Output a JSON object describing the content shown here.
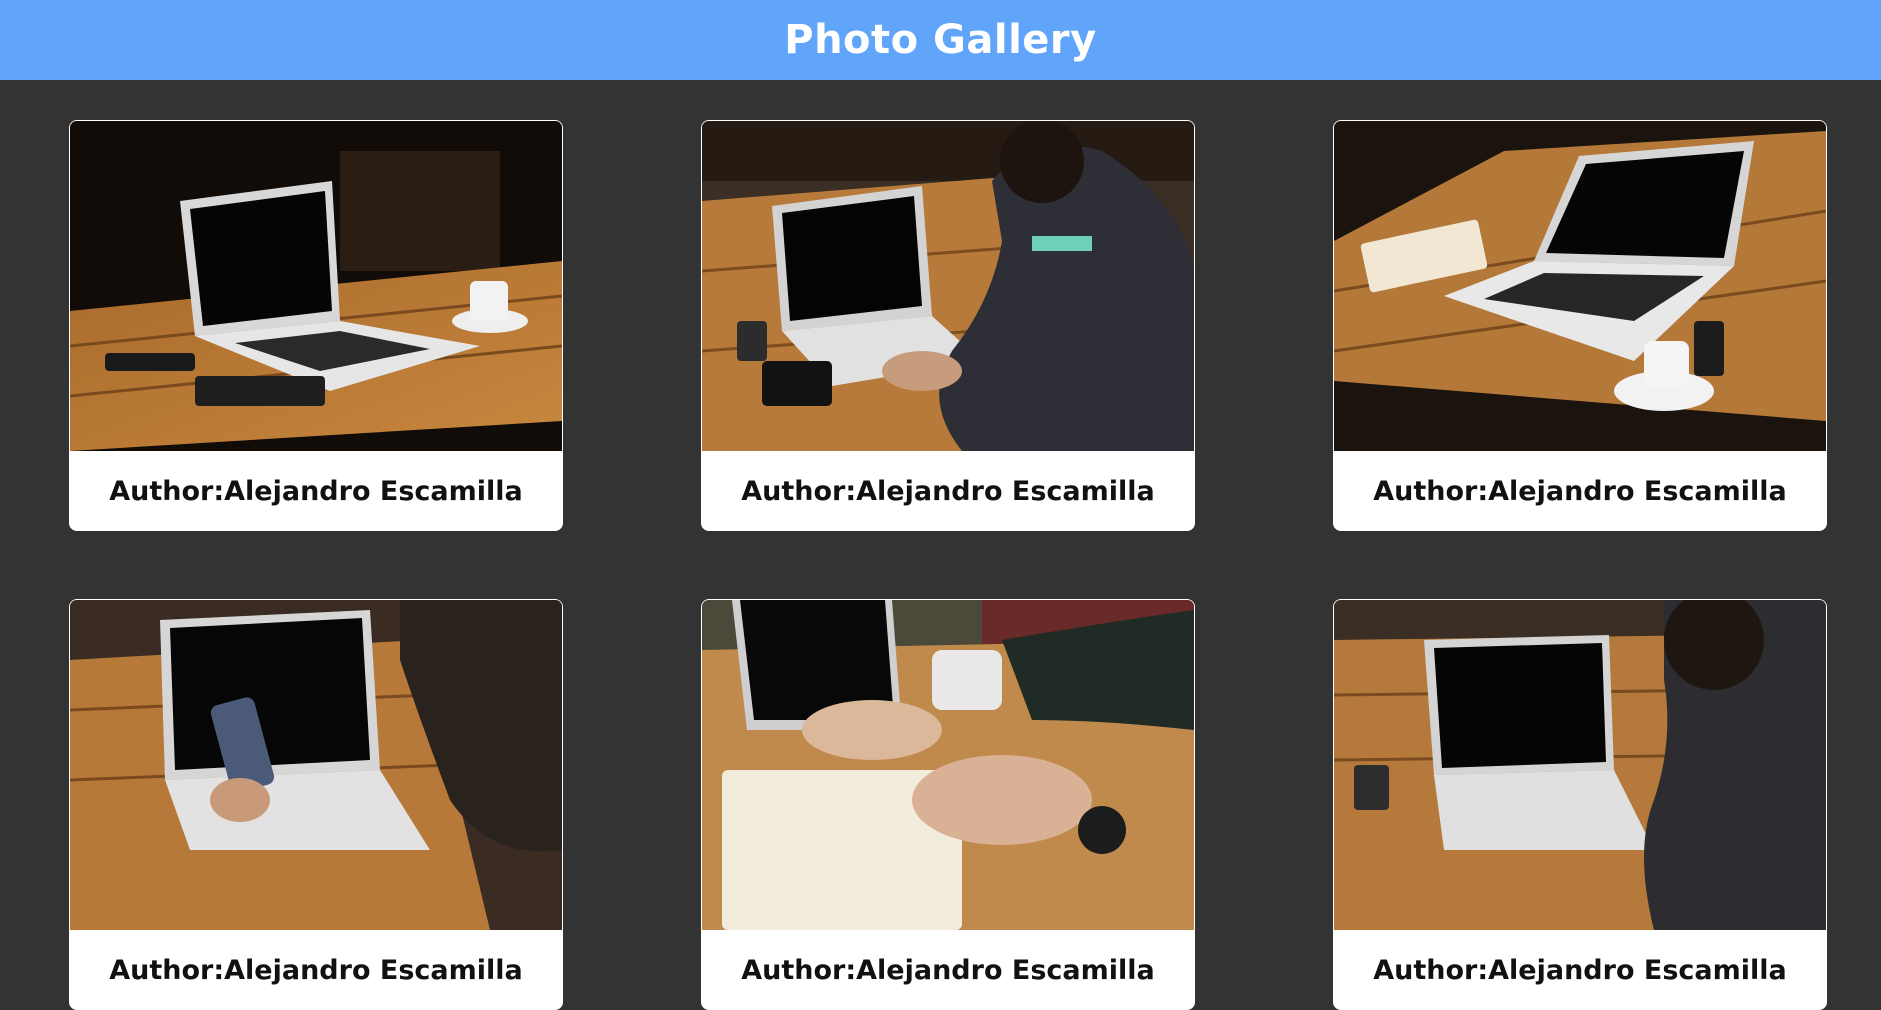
{
  "header": {
    "title": "Photo Gallery"
  },
  "gallery": {
    "items": [
      {
        "author_text": "Author:Alejandro Escamilla",
        "scene": "laptop-coffee-notebook"
      },
      {
        "author_text": "Author:Alejandro Escamilla",
        "scene": "man-typing-laptop"
      },
      {
        "author_text": "Author:Alejandro Escamilla",
        "scene": "laptop-notebook-coffee-phone"
      },
      {
        "author_text": "Author:Alejandro Escamilla",
        "scene": "hand-holding-phone-laptop"
      },
      {
        "author_text": "Author:Alejandro Escamilla",
        "scene": "hand-writing-notebook"
      },
      {
        "author_text": "Author:Alejandro Escamilla",
        "scene": "man-laptop-table"
      }
    ]
  },
  "colors": {
    "header_bg": "#60a5fa",
    "page_bg": "#333333",
    "card_bg": "#ffffff"
  }
}
